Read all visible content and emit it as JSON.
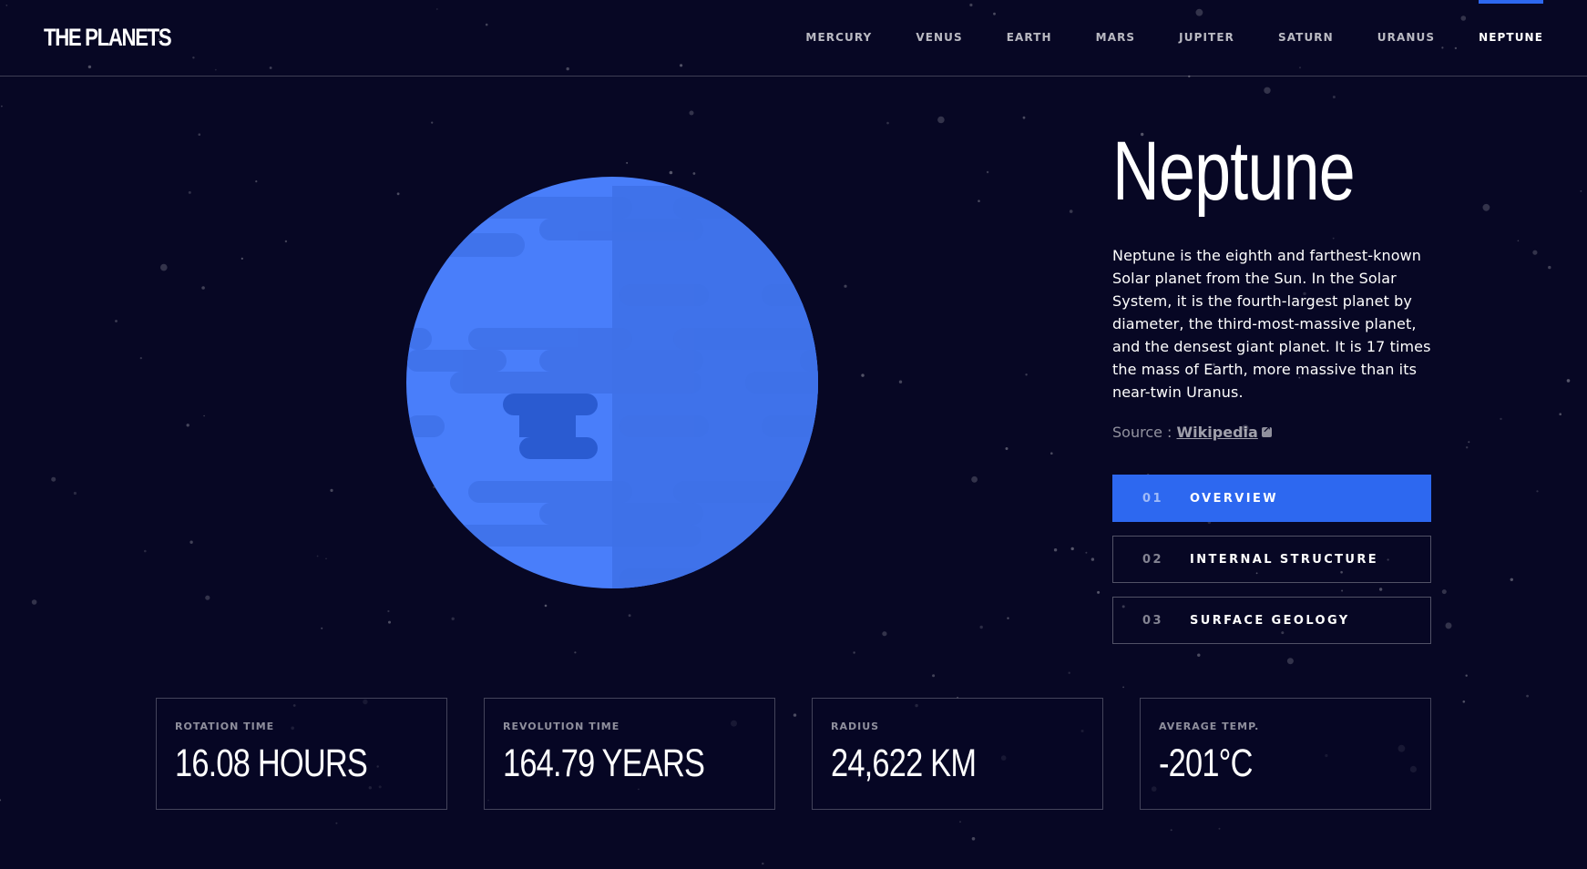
{
  "header": {
    "logo": "THE PLANETS",
    "nav": [
      "MERCURY",
      "VENUS",
      "EARTH",
      "MARS",
      "JUPITER",
      "SATURN",
      "URANUS",
      "NEPTUNE"
    ],
    "active": "NEPTUNE"
  },
  "planet": {
    "name": "Neptune",
    "description": "Neptune is the eighth and farthest-known Solar planet from the Sun. In the Solar System, it is the fourth-largest planet by diameter, the third-most-massive planet, and the densest giant planet. It is 17 times the mass of Earth, more massive than its near-twin Uranus.",
    "source_prefix": "Source : ",
    "source_link": "Wikipedia",
    "source_icon": "external-link-icon",
    "illustration_icon": "neptune-planet-icon"
  },
  "tabs": [
    {
      "num": "01",
      "label": "OVERVIEW",
      "active": true
    },
    {
      "num": "02",
      "label": "INTERNAL STRUCTURE",
      "active": false
    },
    {
      "num": "03",
      "label": "SURFACE GEOLOGY",
      "active": false
    }
  ],
  "stats": [
    {
      "label": "ROTATION TIME",
      "value": "16.08 HOURS"
    },
    {
      "label": "REVOLUTION TIME",
      "value": "164.79 YEARS"
    },
    {
      "label": "RADIUS",
      "value": "24,622 KM"
    },
    {
      "label": "AVERAGE TEMP.",
      "value": "-201°C"
    }
  ],
  "colors": {
    "background": "#070724",
    "accent": "#2d68f0",
    "planet_light": "#497efa",
    "planet_dark": "#2d68f0"
  }
}
